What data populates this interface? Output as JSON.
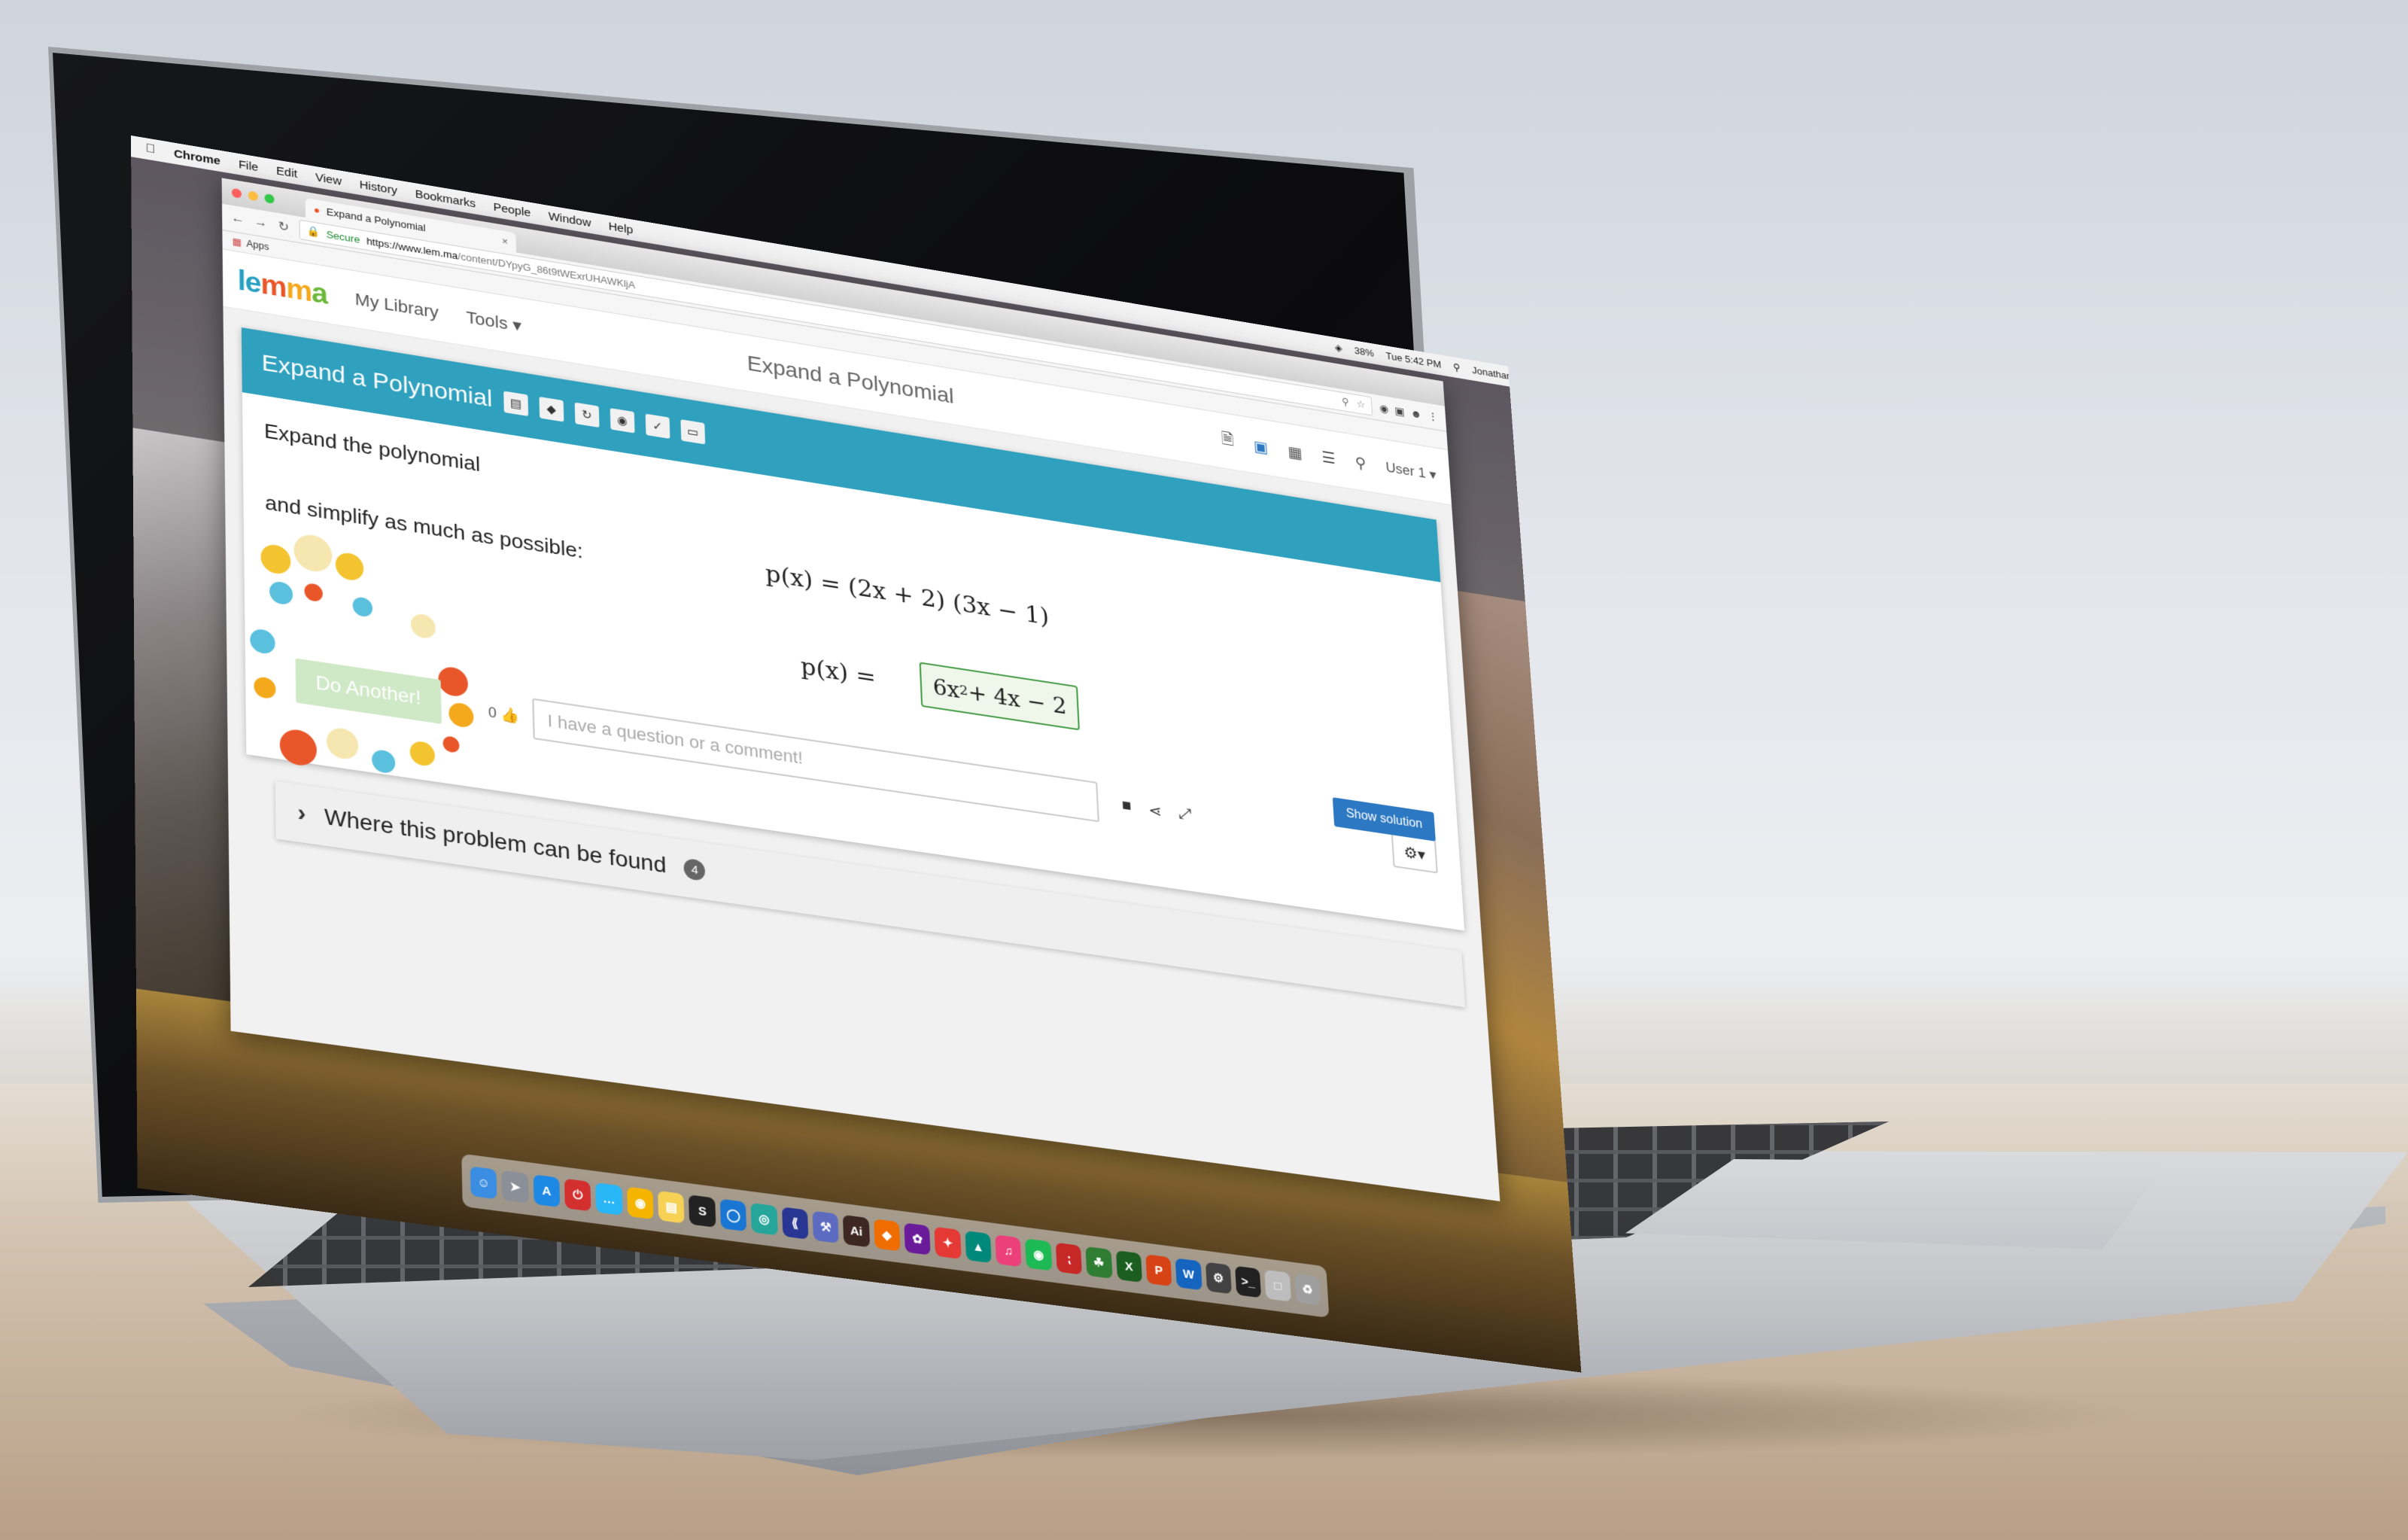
{
  "os_menubar": {
    "apple_icon": "apple-icon",
    "app_name": "Chrome",
    "menus": [
      "File",
      "Edit",
      "View",
      "History",
      "Bookmarks",
      "People",
      "Window",
      "Help"
    ],
    "battery": "38%",
    "clock": "Tue 5:42 PM",
    "user": "Jonathan"
  },
  "browser": {
    "tab_title": "Expand a Polynomial",
    "tab_close": "×",
    "secure_label": "Secure",
    "url_host": "https://www.lem.ma",
    "url_path": "/content/DYpyG_86t9tWExrUHAWKljA",
    "bookmarks_apps": "Apps"
  },
  "site": {
    "logo": {
      "l1": "le",
      "l2": "m",
      "l3": "m",
      "l4": "a"
    },
    "nav": {
      "my_library": "My Library",
      "tools": "Tools ▾"
    },
    "page_heading": "Expand a Polynomial",
    "user_menu": "User 1 ▾"
  },
  "problem": {
    "title": "Expand a Polynomial",
    "prompt_line1": "Expand the polynomial",
    "prompt_line2": "and simplify as much as possible:",
    "expression": "p(x) = (2x + 2) (3x − 1)",
    "answer_label": "p(x) =",
    "answer": {
      "coef": "6x",
      "power": "2",
      "rest": " + 4x − 2"
    },
    "show_solution": "Show solution",
    "do_another": "Do Another!",
    "like_count": "0",
    "comment_placeholder": "I have a question or a comment!"
  },
  "found_panel": {
    "label": "Where this problem can be found",
    "count": "4"
  },
  "colors": {
    "header_teal": "#2fa0be",
    "primary_blue": "#2c78c2",
    "answer_green": "#4a9d4a"
  }
}
